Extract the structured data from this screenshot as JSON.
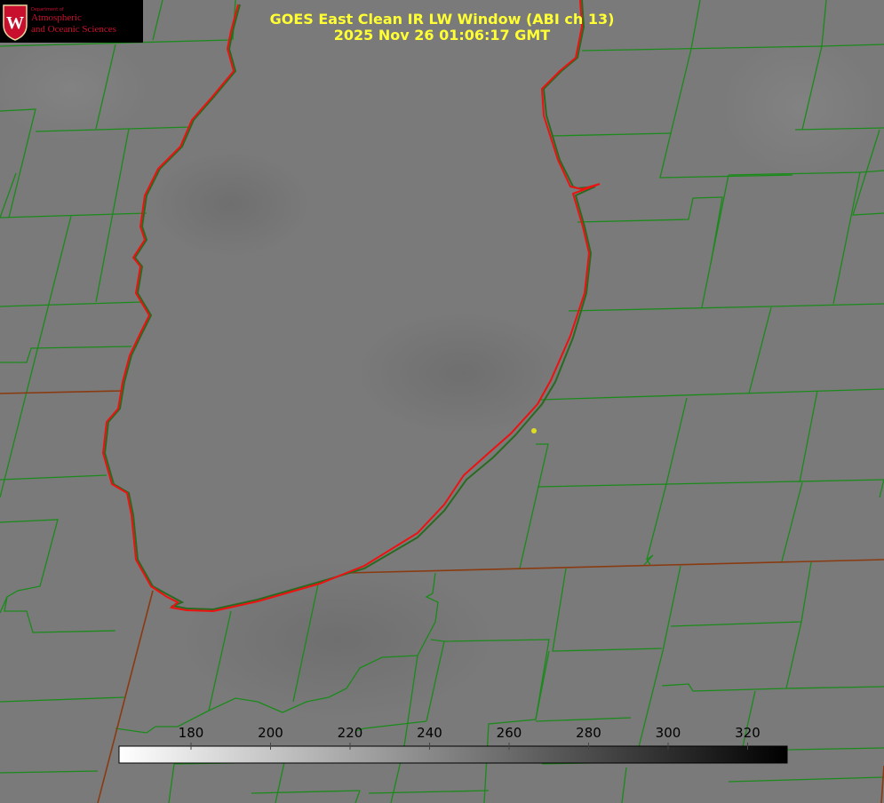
{
  "header": {
    "title_line1": "GOES East Clean IR LW Window (ABI ch 13)",
    "title_line2": "2025 Nov 26 01:06:17 GMT"
  },
  "logo": {
    "department": "Department of",
    "name_line1": "Atmospheric",
    "name_line2": "and Oceanic Sciences",
    "crest_letter": "W",
    "color": "#c8102e"
  },
  "colorbar": {
    "ticks": [
      "180",
      "200",
      "220",
      "240",
      "260",
      "280",
      "300",
      "320"
    ],
    "gradient_from": "#ffffff",
    "gradient_to": "#000000"
  },
  "colors": {
    "background": "#7a7a7a",
    "county_lines": "#1a8a1a",
    "lake_outline": "#ee1111",
    "title_text": "#ffff33",
    "station_marker": "#dddd22"
  }
}
